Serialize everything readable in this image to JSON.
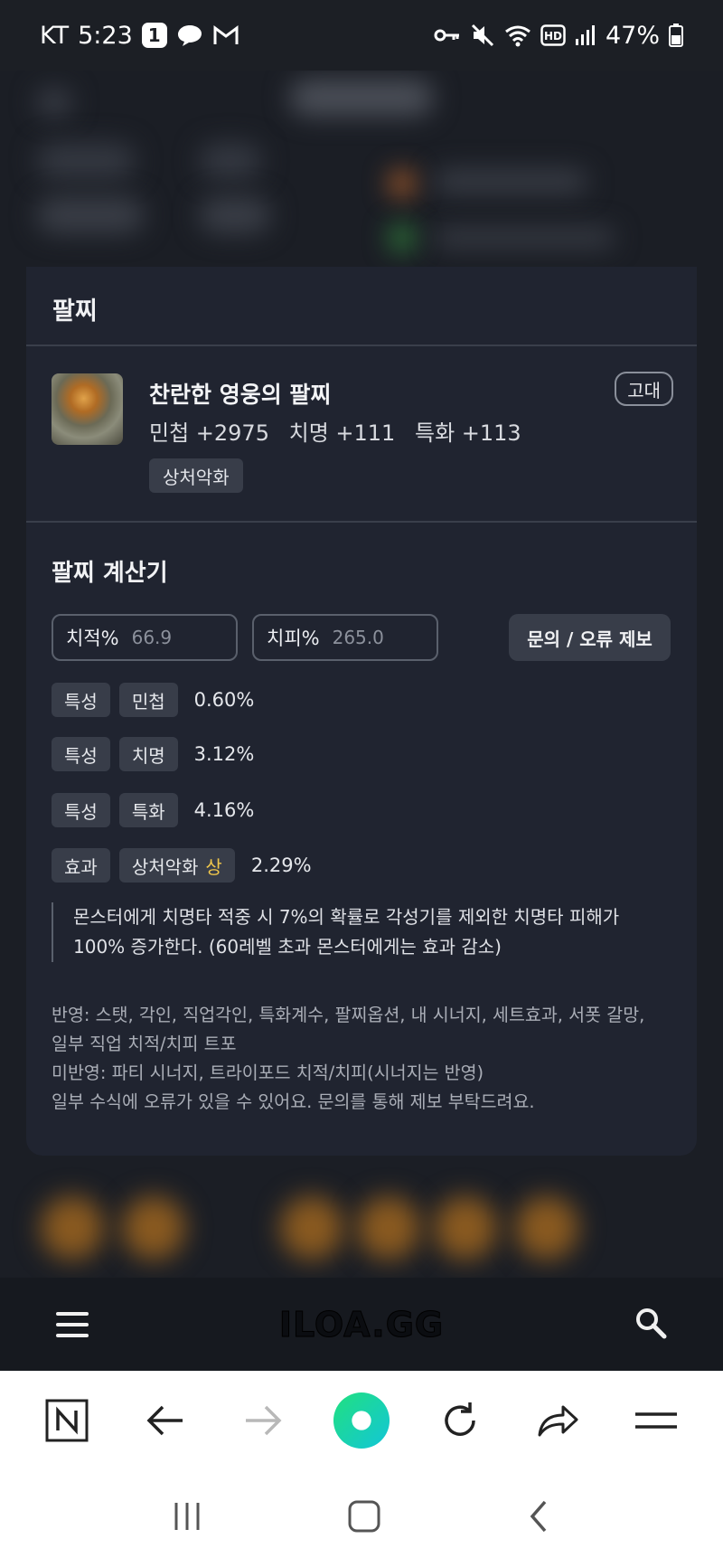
{
  "status_bar": {
    "carrier": "KT",
    "time": "5:23",
    "notif_badge": "1",
    "battery": "47%",
    "icons": [
      "talk-icon",
      "gmail-icon",
      "key-icon",
      "mute-icon",
      "wifi-icon",
      "hd-icon",
      "signal-icon",
      "battery-icon"
    ]
  },
  "modal": {
    "header": "팔찌",
    "item": {
      "name": "찬란한 영웅의 팔찌",
      "stats": [
        "민첩 +2975",
        "치명 +111",
        "특화 +113"
      ],
      "tag": "상처악화",
      "grade": "고대"
    },
    "calculator": {
      "title": "팔찌 계산기",
      "crit_rate": {
        "label": "치적%",
        "value": "66.9"
      },
      "crit_damage": {
        "label": "치피%",
        "value": "265.0"
      },
      "report_button": "문의 / 오류 제보",
      "options": [
        {
          "type": "특성",
          "name": "민첩",
          "value": "0.60%"
        },
        {
          "type": "특성",
          "name": "치명",
          "value": "3.12%"
        },
        {
          "type": "특성",
          "name": "특화",
          "value": "4.16%"
        }
      ],
      "effect": {
        "type": "효과",
        "name": "상처악화",
        "grade": "상",
        "value": "2.29%",
        "description_line1": "몬스터에게 치명타 적중 시 7%의 확률로 각성기를 제외한 치명타 피해가",
        "description_line2": "100% 증가한다. (60레벨 초과 몬스터에게는 효과 감소)"
      },
      "notes": [
        "반영: 스탯, 각인, 직업각인, 특화계수, 팔찌옵션, 내 시너지, 세트효과, 서폿 갈망,",
        "일부 직업 치적/치피 트포",
        "미반영: 파티 시너지, 트라이포드 치적/치피(시너지는 반영)",
        "일부 수식에 오류가 있을 수 있어요. 문의를 통해 제보 부탁드려요."
      ]
    }
  },
  "site_bar": {
    "logo": "ILOA.GG"
  },
  "colors": {
    "background": "#14171d",
    "card": "#202430",
    "chip": "#383d49",
    "highlight": "#f2c84b",
    "browser_accent": "#1ed6a6"
  }
}
